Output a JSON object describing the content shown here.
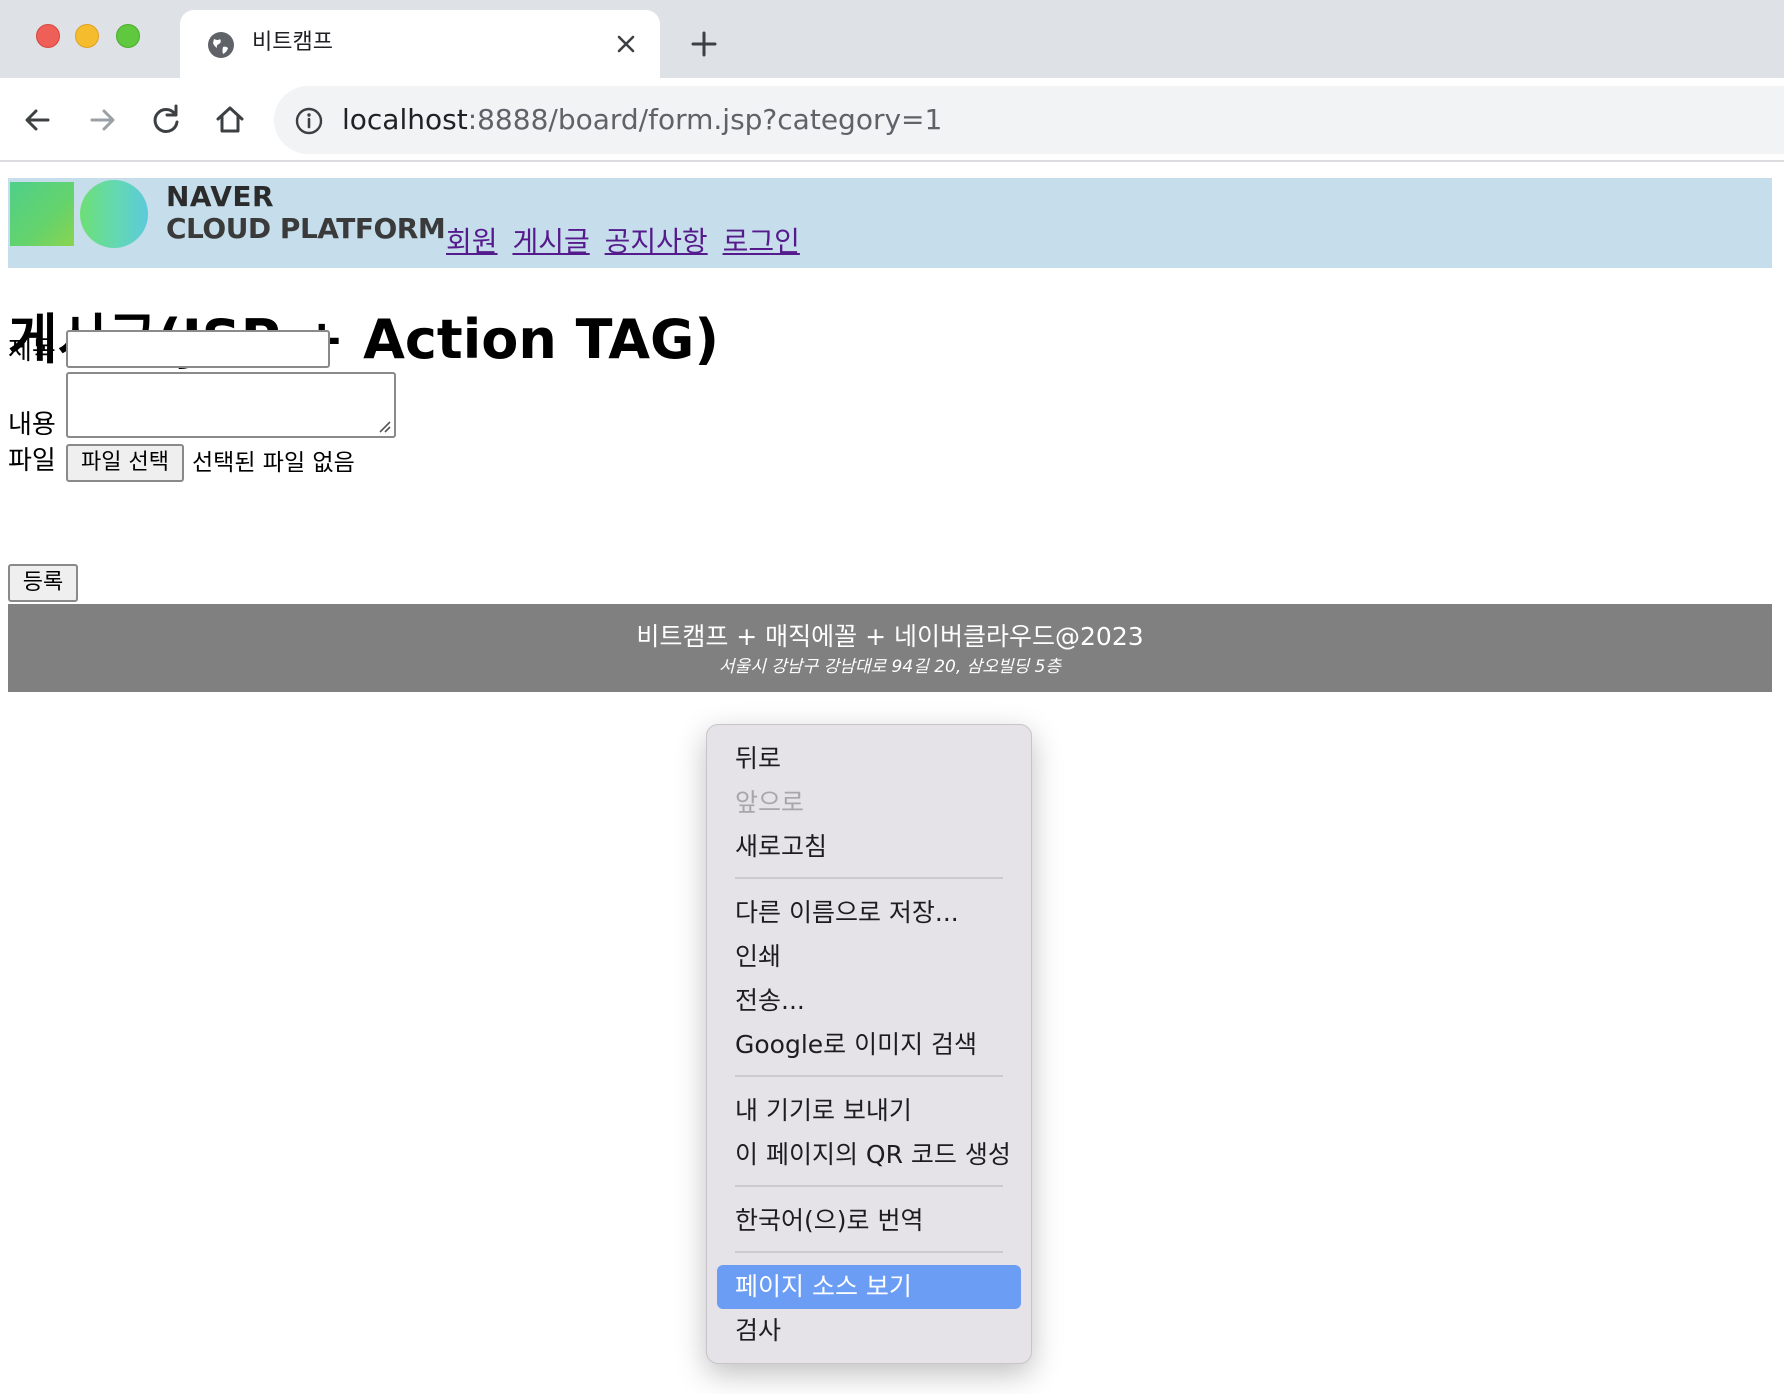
{
  "browser": {
    "tab_title": "비트캠프",
    "url_host": "localhost",
    "url_rest": ":8888/board/form.jsp?category=1"
  },
  "header": {
    "logo_line1": "NAVER",
    "logo_line2": "CLOUD PLATFORM",
    "nav": [
      "회원",
      "게시글",
      "공지사항",
      "로그인"
    ]
  },
  "main": {
    "title": "게시글(JSP + Action TAG)",
    "form": {
      "title_label": "제목",
      "content_label": "내용",
      "file_label": "파일",
      "file_button": "파일 선택",
      "file_status": "선택된 파일 없음",
      "submit": "등록"
    }
  },
  "footer": {
    "main": "비트캠프 + 매직에꼴 + 네이버클라우드@2023",
    "address": "서울시 강남구 강남대로 94길 20, 삼오빌딩 5층"
  },
  "context_menu": {
    "items": [
      {
        "label": "뒤로"
      },
      {
        "label": "앞으로",
        "disabled": true
      },
      {
        "label": "새로고침"
      },
      {
        "label": "다른 이름으로 저장..."
      },
      {
        "label": "인쇄"
      },
      {
        "label": "전송..."
      },
      {
        "label": "Google로 이미지 검색"
      },
      {
        "label": "내 기기로 보내기"
      },
      {
        "label": "이 페이지의 QR 코드 생성"
      },
      {
        "label": "한국어(으)로 번역"
      },
      {
        "label": "페이지 소스 보기",
        "highlighted": true
      },
      {
        "label": "검사"
      }
    ]
  },
  "colors": {
    "header_bg": "#c6ddeb",
    "footer_bg": "#808080",
    "link": "#551a8b",
    "menu_highlight": "#6b9df5"
  }
}
